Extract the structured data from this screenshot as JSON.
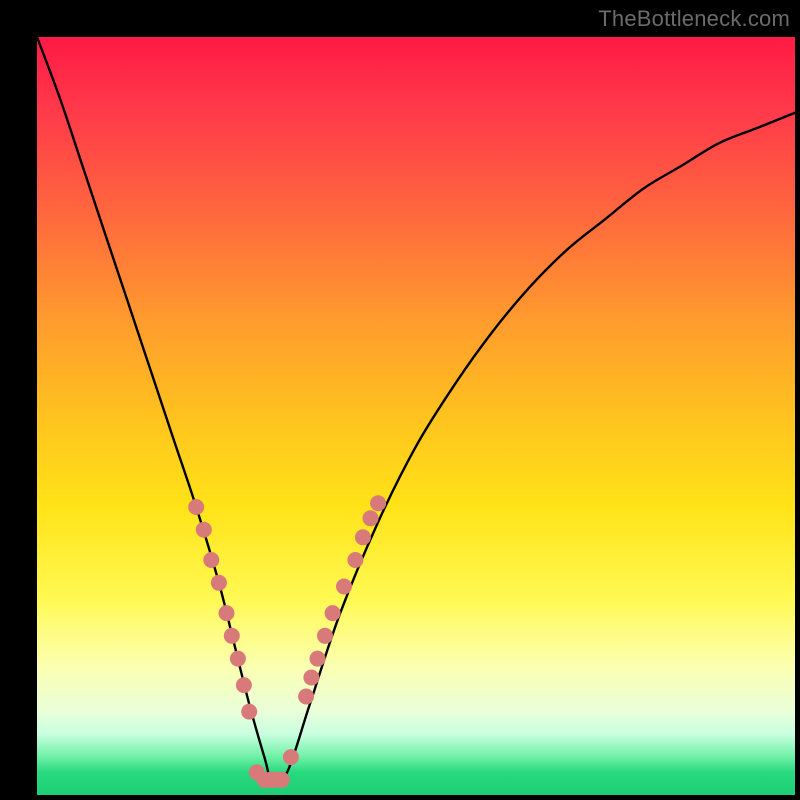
{
  "watermark": {
    "text": "TheBottleneck.com"
  },
  "chart_data": {
    "type": "line",
    "title": "",
    "xlabel": "",
    "ylabel": "",
    "xlim": [
      0,
      100
    ],
    "ylim": [
      0,
      100
    ],
    "grid": false,
    "legend": false,
    "series": [
      {
        "name": "bottleneck-curve",
        "x": [
          0,
          3,
          6,
          9,
          12,
          15,
          18,
          21,
          24,
          26,
          28,
          30,
          31,
          33,
          36,
          40,
          45,
          50,
          55,
          60,
          65,
          70,
          75,
          80,
          85,
          90,
          95,
          100
        ],
        "values": [
          100,
          92,
          83,
          74,
          65,
          56,
          47,
          38,
          28,
          20,
          12,
          5,
          2,
          3,
          12,
          24,
          36,
          46,
          54,
          61,
          67,
          72,
          76,
          80,
          83,
          86,
          88,
          90
        ]
      }
    ],
    "markers": {
      "name": "highlight-dots",
      "color": "#d97a7a",
      "radius_px": 8,
      "points": [
        {
          "x": 21.0,
          "y": 38.0
        },
        {
          "x": 22.0,
          "y": 35.0
        },
        {
          "x": 23.0,
          "y": 31.0
        },
        {
          "x": 24.0,
          "y": 28.0
        },
        {
          "x": 25.0,
          "y": 24.0
        },
        {
          "x": 25.7,
          "y": 21.0
        },
        {
          "x": 26.5,
          "y": 18.0
        },
        {
          "x": 27.3,
          "y": 14.5
        },
        {
          "x": 28.0,
          "y": 11.0
        },
        {
          "x": 29.0,
          "y": 3.0
        },
        {
          "x": 30.0,
          "y": 2.0
        },
        {
          "x": 30.8,
          "y": 2.0
        },
        {
          "x": 31.5,
          "y": 2.0
        },
        {
          "x": 32.3,
          "y": 2.0
        },
        {
          "x": 33.5,
          "y": 5.0
        },
        {
          "x": 35.5,
          "y": 13.0
        },
        {
          "x": 36.2,
          "y": 15.5
        },
        {
          "x": 37.0,
          "y": 18.0
        },
        {
          "x": 38.0,
          "y": 21.0
        },
        {
          "x": 39.0,
          "y": 24.0
        },
        {
          "x": 40.5,
          "y": 27.5
        },
        {
          "x": 42.0,
          "y": 31.0
        },
        {
          "x": 43.0,
          "y": 34.0
        },
        {
          "x": 44.0,
          "y": 36.5
        },
        {
          "x": 45.0,
          "y": 38.5
        }
      ]
    },
    "background": {
      "type": "vertical-gradient",
      "stops": [
        {
          "pos": 0.0,
          "color": "#ff1a45"
        },
        {
          "pos": 0.5,
          "color": "#ffc21e"
        },
        {
          "pos": 0.83,
          "color": "#fbffb0"
        },
        {
          "pos": 1.0,
          "color": "#1dce74"
        }
      ]
    }
  }
}
